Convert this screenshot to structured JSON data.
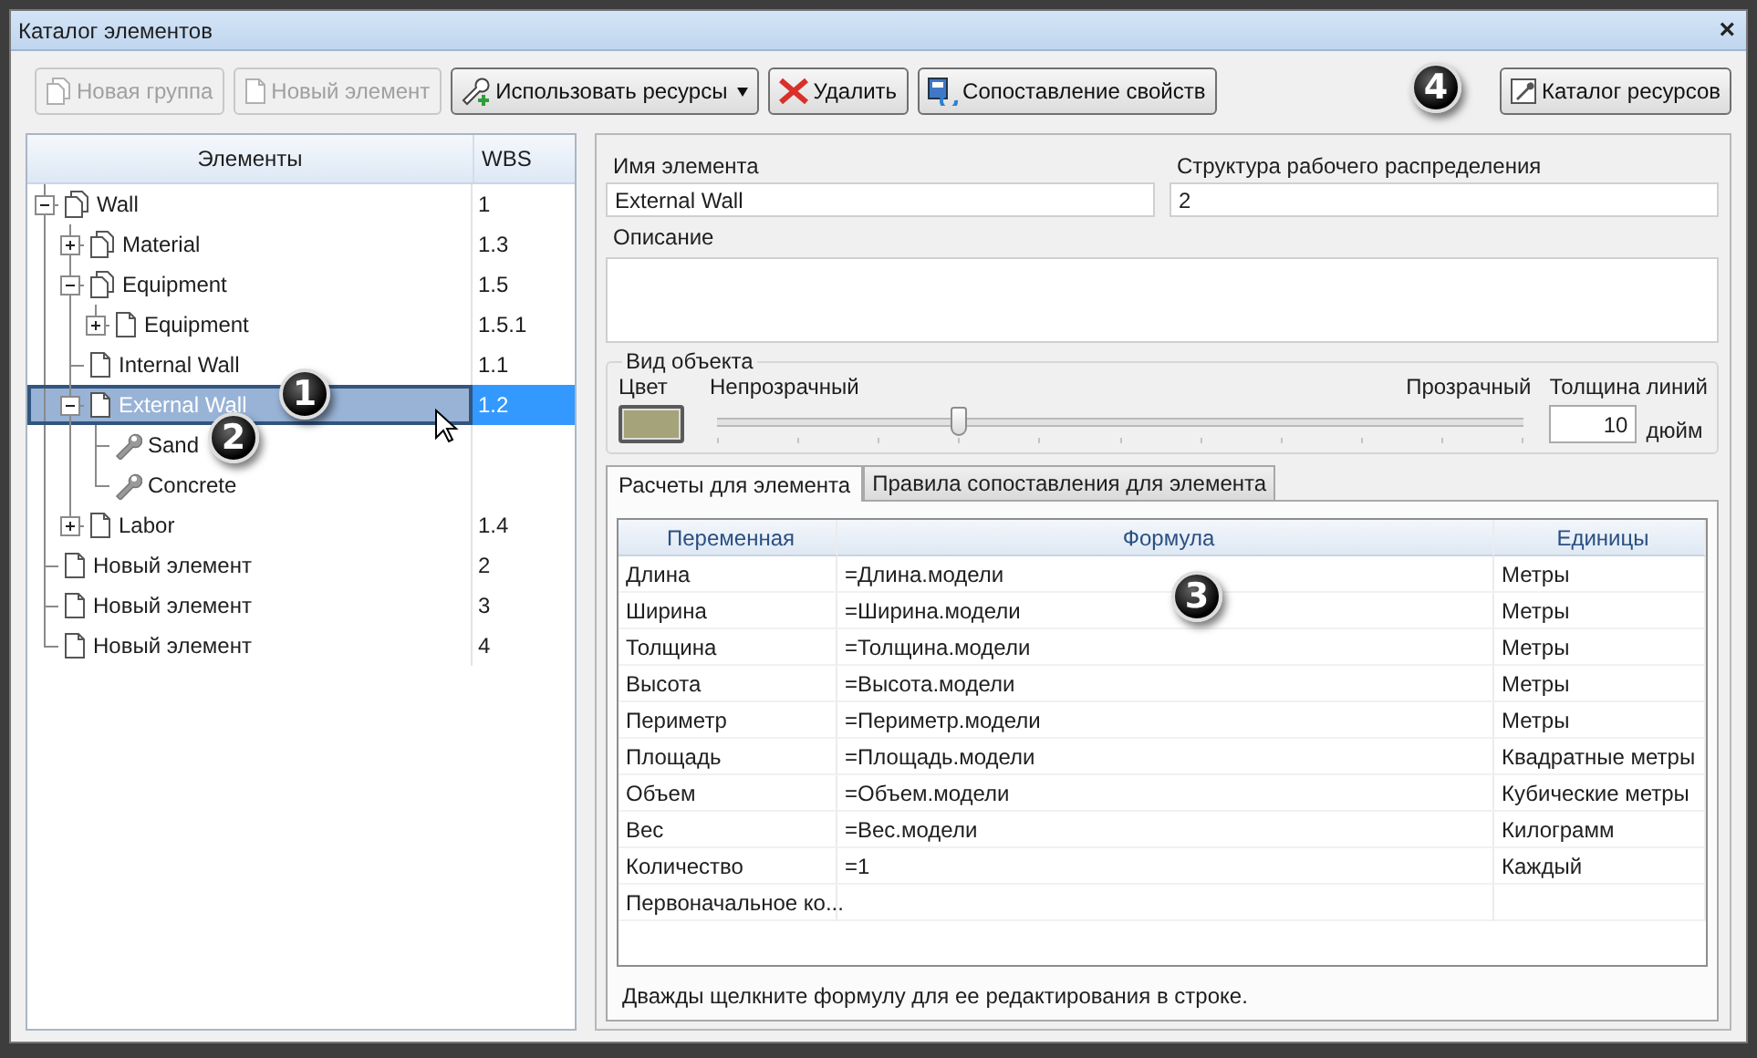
{
  "window": {
    "title": "Каталог элементов",
    "close": "×"
  },
  "toolbar": [
    {
      "label": "Новая группа",
      "kind": "group",
      "disabled": true,
      "dropdown": false
    },
    {
      "label": "Новый элемент",
      "kind": "element",
      "disabled": true,
      "dropdown": false
    },
    {
      "label": "Использовать ресурсы",
      "kind": "wrench-add",
      "disabled": false,
      "dropdown": true
    },
    {
      "label": "Удалить",
      "kind": "delete",
      "disabled": false,
      "dropdown": false
    },
    {
      "label": "Сопоставление свойств",
      "kind": "map",
      "disabled": false,
      "dropdown": false
    }
  ],
  "toolbar_right": [
    {
      "label": "Каталог ресурсов",
      "kind": "catalog",
      "disabled": false,
      "dropdown": false
    }
  ],
  "tree": {
    "columns": [
      "Элементы",
      "WBS"
    ],
    "nodes": [
      {
        "label": "Wall",
        "wbs": "1",
        "kind": "group",
        "expanded": true,
        "selected": false,
        "children": [
          {
            "label": "Material",
            "wbs": "1.3",
            "kind": "group",
            "expanded": false,
            "selected": false
          },
          {
            "label": "Equipment",
            "wbs": "1.5",
            "kind": "group",
            "expanded": true,
            "selected": false,
            "children": [
              {
                "label": "Equipment",
                "wbs": "1.5.1",
                "kind": "element",
                "expanded": false,
                "selected": false
              }
            ]
          },
          {
            "label": "Internal Wall",
            "wbs": "1.1",
            "kind": "element",
            "selected": false
          },
          {
            "label": "External Wall",
            "wbs": "1.2",
            "kind": "element",
            "expanded": true,
            "selected": true,
            "children": [
              {
                "label": "Sand",
                "kind": "resource",
                "selected": false
              },
              {
                "label": "Concrete",
                "kind": "resource",
                "selected": false
              }
            ]
          },
          {
            "label": "Labor",
            "wbs": "1.4",
            "kind": "element",
            "expanded": false,
            "selected": false
          }
        ]
      },
      {
        "label": "Новый элемент",
        "wbs": "2",
        "kind": "element",
        "selected": false
      },
      {
        "label": "Новый элемент",
        "wbs": "3",
        "kind": "element",
        "selected": false
      },
      {
        "label": "Новый элемент",
        "wbs": "4",
        "kind": "element",
        "selected": false
      }
    ]
  },
  "properties": {
    "name_label": "Имя элемента",
    "name_value": "External Wall",
    "wbs_label": "Структура рабочего распределения",
    "wbs_value": "2",
    "description_label": "Описание"
  },
  "appearance": {
    "title": "Вид объекта",
    "color_label": "Цвет",
    "color": "#a4a379",
    "opaque_label": "Непрозрачный",
    "transparent_label": "Прозрачный",
    "level": 0.3,
    "thickness_label": "Толщина линий",
    "thickness_value": "10",
    "thickness_unit": "дюйм"
  },
  "tabs": [
    {
      "label": "Расчеты для элемента",
      "selected": true
    },
    {
      "label": "Правила сопоставления для элемента",
      "selected": false
    }
  ],
  "calc_table": {
    "columns": [
      "Переменная",
      "Формула",
      "Единицы"
    ],
    "rows": [
      {
        "variable": "Длина",
        "formula": "=Длина.модели",
        "units": "Метры"
      },
      {
        "variable": "Ширина",
        "formula": "=Ширина.модели",
        "units": "Метры"
      },
      {
        "variable": "Толщина",
        "formula": "=Толщина.модели",
        "units": "Метры"
      },
      {
        "variable": "Высота",
        "formula": "=Высота.модели",
        "units": "Метры"
      },
      {
        "variable": "Периметр",
        "formula": "=Периметр.модели",
        "units": "Метры"
      },
      {
        "variable": "Площадь",
        "formula": "=Площадь.модели",
        "units": "Квадратные метры"
      },
      {
        "variable": "Объем",
        "formula": "=Объем.модели",
        "units": "Кубические метры"
      },
      {
        "variable": "Вес",
        "formula": "=Вес.модели",
        "units": "Килограмм"
      },
      {
        "variable": "Количество",
        "formula": "=1",
        "units": "Каждый"
      },
      {
        "variable": "Первоначальное ко..."
      }
    ]
  },
  "hint": "Дважды щелкните формулу для ее редактирования в строке.",
  "callouts": [
    {
      "label": "1"
    },
    {
      "label": "2"
    },
    {
      "label": "3"
    },
    {
      "label": "4"
    }
  ]
}
